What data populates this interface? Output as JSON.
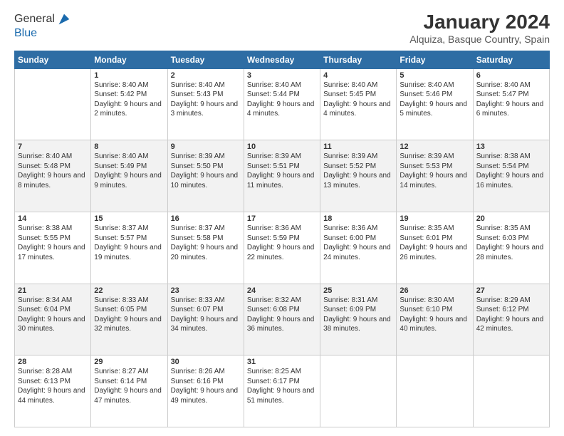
{
  "logo": {
    "general": "General",
    "blue": "Blue"
  },
  "title": "January 2024",
  "subtitle": "Alquiza, Basque Country, Spain",
  "weekdays": [
    "Sunday",
    "Monday",
    "Tuesday",
    "Wednesday",
    "Thursday",
    "Friday",
    "Saturday"
  ],
  "weeks": [
    [
      {
        "day": null,
        "sunrise": null,
        "sunset": null,
        "daylight": null
      },
      {
        "day": "1",
        "sunrise": "Sunrise: 8:40 AM",
        "sunset": "Sunset: 5:42 PM",
        "daylight": "Daylight: 9 hours and 2 minutes."
      },
      {
        "day": "2",
        "sunrise": "Sunrise: 8:40 AM",
        "sunset": "Sunset: 5:43 PM",
        "daylight": "Daylight: 9 hours and 3 minutes."
      },
      {
        "day": "3",
        "sunrise": "Sunrise: 8:40 AM",
        "sunset": "Sunset: 5:44 PM",
        "daylight": "Daylight: 9 hours and 4 minutes."
      },
      {
        "day": "4",
        "sunrise": "Sunrise: 8:40 AM",
        "sunset": "Sunset: 5:45 PM",
        "daylight": "Daylight: 9 hours and 4 minutes."
      },
      {
        "day": "5",
        "sunrise": "Sunrise: 8:40 AM",
        "sunset": "Sunset: 5:46 PM",
        "daylight": "Daylight: 9 hours and 5 minutes."
      },
      {
        "day": "6",
        "sunrise": "Sunrise: 8:40 AM",
        "sunset": "Sunset: 5:47 PM",
        "daylight": "Daylight: 9 hours and 6 minutes."
      }
    ],
    [
      {
        "day": "7",
        "sunrise": "Sunrise: 8:40 AM",
        "sunset": "Sunset: 5:48 PM",
        "daylight": "Daylight: 9 hours and 8 minutes."
      },
      {
        "day": "8",
        "sunrise": "Sunrise: 8:40 AM",
        "sunset": "Sunset: 5:49 PM",
        "daylight": "Daylight: 9 hours and 9 minutes."
      },
      {
        "day": "9",
        "sunrise": "Sunrise: 8:39 AM",
        "sunset": "Sunset: 5:50 PM",
        "daylight": "Daylight: 9 hours and 10 minutes."
      },
      {
        "day": "10",
        "sunrise": "Sunrise: 8:39 AM",
        "sunset": "Sunset: 5:51 PM",
        "daylight": "Daylight: 9 hours and 11 minutes."
      },
      {
        "day": "11",
        "sunrise": "Sunrise: 8:39 AM",
        "sunset": "Sunset: 5:52 PM",
        "daylight": "Daylight: 9 hours and 13 minutes."
      },
      {
        "day": "12",
        "sunrise": "Sunrise: 8:39 AM",
        "sunset": "Sunset: 5:53 PM",
        "daylight": "Daylight: 9 hours and 14 minutes."
      },
      {
        "day": "13",
        "sunrise": "Sunrise: 8:38 AM",
        "sunset": "Sunset: 5:54 PM",
        "daylight": "Daylight: 9 hours and 16 minutes."
      }
    ],
    [
      {
        "day": "14",
        "sunrise": "Sunrise: 8:38 AM",
        "sunset": "Sunset: 5:55 PM",
        "daylight": "Daylight: 9 hours and 17 minutes."
      },
      {
        "day": "15",
        "sunrise": "Sunrise: 8:37 AM",
        "sunset": "Sunset: 5:57 PM",
        "daylight": "Daylight: 9 hours and 19 minutes."
      },
      {
        "day": "16",
        "sunrise": "Sunrise: 8:37 AM",
        "sunset": "Sunset: 5:58 PM",
        "daylight": "Daylight: 9 hours and 20 minutes."
      },
      {
        "day": "17",
        "sunrise": "Sunrise: 8:36 AM",
        "sunset": "Sunset: 5:59 PM",
        "daylight": "Daylight: 9 hours and 22 minutes."
      },
      {
        "day": "18",
        "sunrise": "Sunrise: 8:36 AM",
        "sunset": "Sunset: 6:00 PM",
        "daylight": "Daylight: 9 hours and 24 minutes."
      },
      {
        "day": "19",
        "sunrise": "Sunrise: 8:35 AM",
        "sunset": "Sunset: 6:01 PM",
        "daylight": "Daylight: 9 hours and 26 minutes."
      },
      {
        "day": "20",
        "sunrise": "Sunrise: 8:35 AM",
        "sunset": "Sunset: 6:03 PM",
        "daylight": "Daylight: 9 hours and 28 minutes."
      }
    ],
    [
      {
        "day": "21",
        "sunrise": "Sunrise: 8:34 AM",
        "sunset": "Sunset: 6:04 PM",
        "daylight": "Daylight: 9 hours and 30 minutes."
      },
      {
        "day": "22",
        "sunrise": "Sunrise: 8:33 AM",
        "sunset": "Sunset: 6:05 PM",
        "daylight": "Daylight: 9 hours and 32 minutes."
      },
      {
        "day": "23",
        "sunrise": "Sunrise: 8:33 AM",
        "sunset": "Sunset: 6:07 PM",
        "daylight": "Daylight: 9 hours and 34 minutes."
      },
      {
        "day": "24",
        "sunrise": "Sunrise: 8:32 AM",
        "sunset": "Sunset: 6:08 PM",
        "daylight": "Daylight: 9 hours and 36 minutes."
      },
      {
        "day": "25",
        "sunrise": "Sunrise: 8:31 AM",
        "sunset": "Sunset: 6:09 PM",
        "daylight": "Daylight: 9 hours and 38 minutes."
      },
      {
        "day": "26",
        "sunrise": "Sunrise: 8:30 AM",
        "sunset": "Sunset: 6:10 PM",
        "daylight": "Daylight: 9 hours and 40 minutes."
      },
      {
        "day": "27",
        "sunrise": "Sunrise: 8:29 AM",
        "sunset": "Sunset: 6:12 PM",
        "daylight": "Daylight: 9 hours and 42 minutes."
      }
    ],
    [
      {
        "day": "28",
        "sunrise": "Sunrise: 8:28 AM",
        "sunset": "Sunset: 6:13 PM",
        "daylight": "Daylight: 9 hours and 44 minutes."
      },
      {
        "day": "29",
        "sunrise": "Sunrise: 8:27 AM",
        "sunset": "Sunset: 6:14 PM",
        "daylight": "Daylight: 9 hours and 47 minutes."
      },
      {
        "day": "30",
        "sunrise": "Sunrise: 8:26 AM",
        "sunset": "Sunset: 6:16 PM",
        "daylight": "Daylight: 9 hours and 49 minutes."
      },
      {
        "day": "31",
        "sunrise": "Sunrise: 8:25 AM",
        "sunset": "Sunset: 6:17 PM",
        "daylight": "Daylight: 9 hours and 51 minutes."
      },
      {
        "day": null,
        "sunrise": null,
        "sunset": null,
        "daylight": null
      },
      {
        "day": null,
        "sunrise": null,
        "sunset": null,
        "daylight": null
      },
      {
        "day": null,
        "sunrise": null,
        "sunset": null,
        "daylight": null
      }
    ]
  ]
}
